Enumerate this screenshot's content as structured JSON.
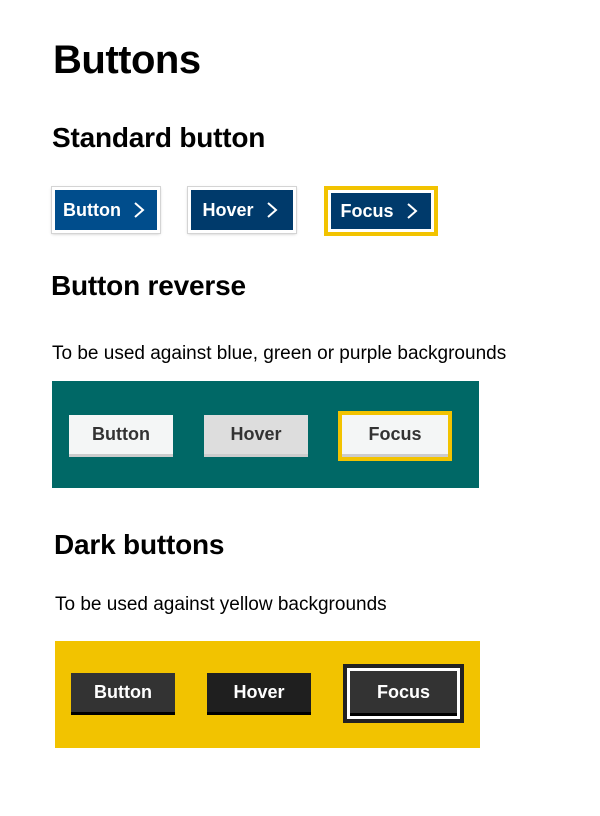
{
  "page": {
    "title": "Buttons"
  },
  "colors": {
    "standard_button": "#004d8c",
    "standard_hover": "#003a6b",
    "focus_ring": "#f2c300",
    "teal_panel": "#006866",
    "reverse_button": "#f4f6f6",
    "reverse_hover": "#dddddd",
    "yellow_panel": "#f2c300",
    "dark_button": "#333333",
    "dark_hover": "#1f1f1f"
  },
  "standard": {
    "heading": "Standard button",
    "buttons": [
      {
        "label": "Button",
        "state": "default",
        "icon": "chevron-right-icon"
      },
      {
        "label": "Hover",
        "state": "hover",
        "icon": "chevron-right-icon"
      },
      {
        "label": "Focus",
        "state": "focus",
        "icon": "chevron-right-icon"
      }
    ]
  },
  "reverse": {
    "heading": "Button reverse",
    "description": "To be used against blue, green or purple backgrounds",
    "buttons": [
      {
        "label": "Button",
        "state": "default"
      },
      {
        "label": "Hover",
        "state": "hover"
      },
      {
        "label": "Focus",
        "state": "focus"
      }
    ]
  },
  "dark": {
    "heading": "Dark buttons",
    "description": "To be used against yellow backgrounds",
    "buttons": [
      {
        "label": "Button",
        "state": "default"
      },
      {
        "label": "Hover",
        "state": "hover"
      },
      {
        "label": "Focus",
        "state": "focus"
      }
    ]
  }
}
